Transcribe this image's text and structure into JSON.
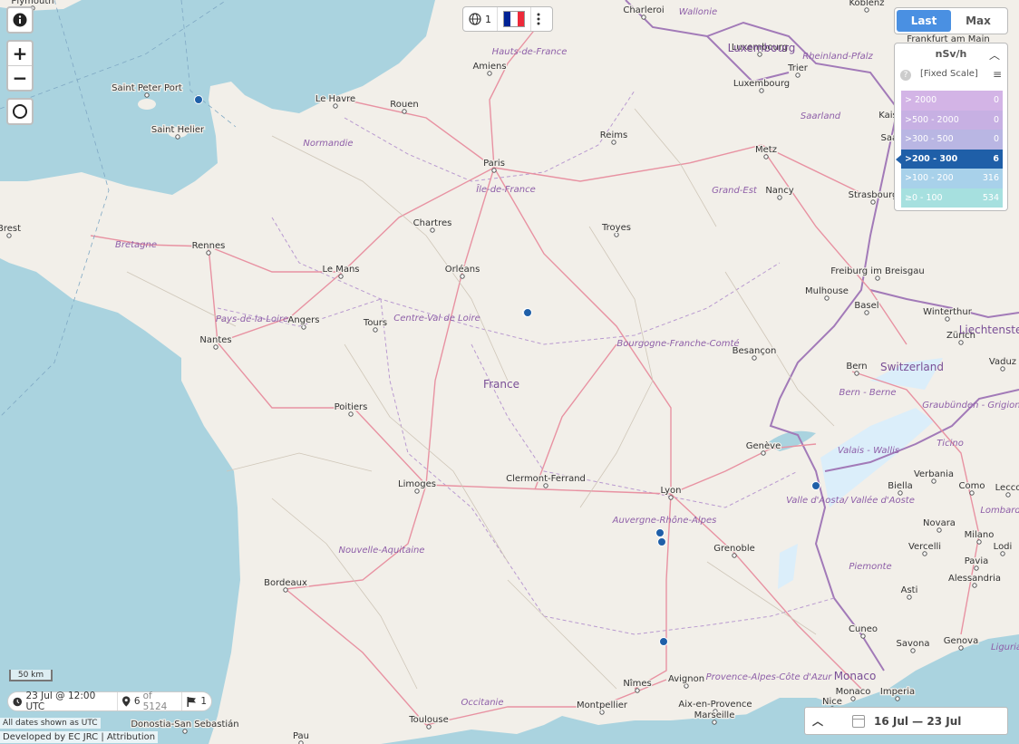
{
  "map": {
    "cities": [
      {
        "name": "Plymouth"
      },
      {
        "name": "Saint Peter Port"
      },
      {
        "name": "Saint Helier"
      },
      {
        "name": "Le Havre"
      },
      {
        "name": "Rouen"
      },
      {
        "name": "Amiens"
      },
      {
        "name": "Charleroi"
      },
      {
        "name": "Koblenz"
      },
      {
        "name": "Luxembourg"
      },
      {
        "name": "Luxembourg"
      },
      {
        "name": "Trier"
      },
      {
        "name": "Frankfurt am Main"
      },
      {
        "name": "Kaiserslautern"
      },
      {
        "name": "Saarbrücken"
      },
      {
        "name": "Reims"
      },
      {
        "name": "Paris"
      },
      {
        "name": "Metz"
      },
      {
        "name": "Nancy"
      },
      {
        "name": "Strasbourg"
      },
      {
        "name": "Brest"
      },
      {
        "name": "Rennes"
      },
      {
        "name": "Chartres"
      },
      {
        "name": "Troyes"
      },
      {
        "name": "Le Mans"
      },
      {
        "name": "Orléans"
      },
      {
        "name": "Freiburg im Breisgau"
      },
      {
        "name": "Mulhouse"
      },
      {
        "name": "Basel"
      },
      {
        "name": "Winterthur"
      },
      {
        "name": "Zürich"
      },
      {
        "name": "Angers"
      },
      {
        "name": "Tours"
      },
      {
        "name": "Nantes"
      },
      {
        "name": "Besançon"
      },
      {
        "name": "Bern"
      },
      {
        "name": "Vaduz"
      },
      {
        "name": "Poitiers"
      },
      {
        "name": "Genève"
      },
      {
        "name": "Limoges"
      },
      {
        "name": "Clermont-Ferrand"
      },
      {
        "name": "Lyon"
      },
      {
        "name": "Biella"
      },
      {
        "name": "Como"
      },
      {
        "name": "Lecco"
      },
      {
        "name": "Novara"
      },
      {
        "name": "Milano"
      },
      {
        "name": "Grenoble"
      },
      {
        "name": "Vercelli"
      },
      {
        "name": "Alessandria"
      },
      {
        "name": "Pavia"
      },
      {
        "name": "Lodi"
      },
      {
        "name": "Bordeaux"
      },
      {
        "name": "Asti"
      },
      {
        "name": "Genova"
      },
      {
        "name": "Cuneo"
      },
      {
        "name": "Savona"
      },
      {
        "name": "Avignon"
      },
      {
        "name": "Nîmes"
      },
      {
        "name": "Aix-en-Provence"
      },
      {
        "name": "Monaco"
      },
      {
        "name": "Imperia"
      },
      {
        "name": "Nice"
      },
      {
        "name": "Montpellier"
      },
      {
        "name": "Toulouse"
      },
      {
        "name": "Marseille"
      },
      {
        "name": "Donostia-San Sebastián"
      },
      {
        "name": "Pau"
      },
      {
        "name": "Verbania"
      }
    ],
    "regions": [
      {
        "name": "Hauts-de-France"
      },
      {
        "name": "Wallonie"
      },
      {
        "name": "Rheinland-Pfalz"
      },
      {
        "name": "Saarland"
      },
      {
        "name": "Normandie"
      },
      {
        "name": "Île-de-France"
      },
      {
        "name": "Grand-Est"
      },
      {
        "name": "Bretagne"
      },
      {
        "name": "Pays-de-la-Loire"
      },
      {
        "name": "Centre-Val de Loire"
      },
      {
        "name": "Bourgogne-Franche-Comté"
      },
      {
        "name": "Bern - Berne"
      },
      {
        "name": "Graubünden - Grigioni - Grischun"
      },
      {
        "name": "Ticino"
      },
      {
        "name": "Valais - Wallis"
      },
      {
        "name": "Valle d'Aosta/ Vallée d'Aoste"
      },
      {
        "name": "Auvergne-Rhône-Alpes"
      },
      {
        "name": "Lombardia"
      },
      {
        "name": "Nouvelle-Aquitaine"
      },
      {
        "name": "Piemonte"
      },
      {
        "name": "Liguria"
      },
      {
        "name": "Provence-Alpes-Côte d'Azur"
      },
      {
        "name": "Occitanie"
      }
    ],
    "countries": [
      {
        "name": "France"
      },
      {
        "name": "Switzerland"
      },
      {
        "name": "Luxembourg"
      },
      {
        "name": "Liechtenstein"
      },
      {
        "name": "Monaco"
      }
    ],
    "markers": [
      {
        "name": "station-1"
      },
      {
        "name": "station-2"
      },
      {
        "name": "station-3"
      },
      {
        "name": "station-4"
      },
      {
        "name": "station-5"
      },
      {
        "name": "station-6"
      },
      {
        "name": "station-7"
      }
    ]
  },
  "toolbar": {
    "globe_count": "1",
    "more_icon": "vertical-dots"
  },
  "toggle": {
    "last": "Last",
    "max": "Max",
    "active": "last"
  },
  "legend": {
    "unit": "nSv/h",
    "scale_label": "[Fixed Scale]",
    "rows": [
      {
        "range": "> 2000",
        "count": "0",
        "color": "#d3b4e6"
      },
      {
        "range": ">500 - 2000",
        "count": "0",
        "color": "#c7b0e3"
      },
      {
        "range": ">300 - 500",
        "count": "0",
        "color": "#b9b6e3"
      },
      {
        "range": ">200 - 300",
        "count": "6",
        "color": "#1f5fa8",
        "selected": true
      },
      {
        "range": ">100 - 200",
        "count": "316",
        "color": "#a8d1ea"
      },
      {
        "range": "≥0 - 100",
        "count": "534",
        "color": "#a6e0df"
      }
    ]
  },
  "scale_bar": "50 km",
  "status": {
    "datetime": "23 Jul @ 12:00 UTC",
    "shown": "6",
    "of_total": "of 5124",
    "flags": "1"
  },
  "notes": {
    "utc": "All dates shown as UTC",
    "credit": "Developed by EC JRC | Attribution"
  },
  "date_range": "16 Jul — 23 Jul",
  "colors": {
    "land": "#f2efe9",
    "sea": "#aad3df",
    "road_major": "#e892a2",
    "border": "#a27ab8",
    "marker": "#1f5fa8",
    "accent": "#4a90e2"
  }
}
